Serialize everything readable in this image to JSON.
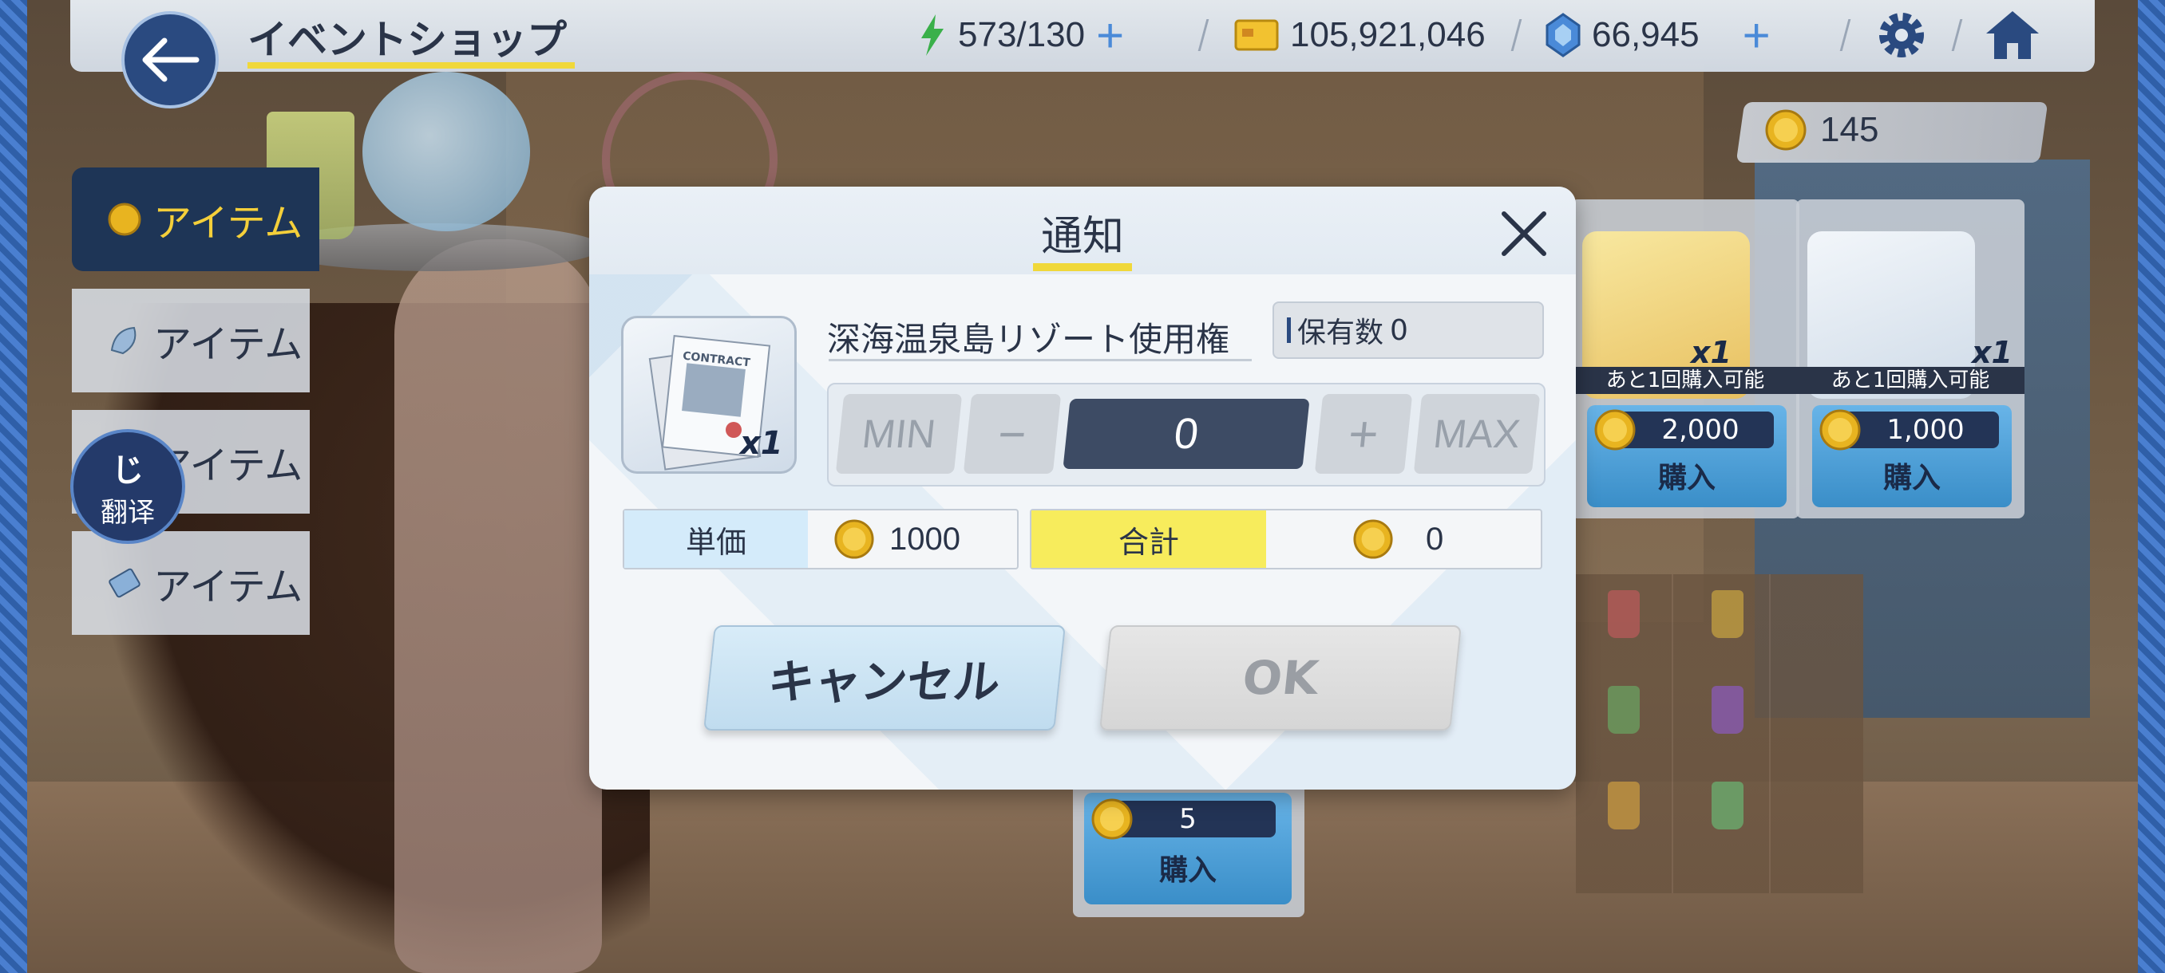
{
  "topbar": {
    "title": "イベントショップ",
    "stamina": "573/130",
    "money": "105,921,046",
    "gems": "66,945"
  },
  "event_coins": "145",
  "tabs": [
    {
      "label": "アイテム",
      "active": true
    },
    {
      "label": "アイテム",
      "active": false
    },
    {
      "label": "アイテム",
      "active": false
    },
    {
      "label": "アイテム",
      "active": false
    }
  ],
  "translate": {
    "label": "翻译",
    "logo": "じ"
  },
  "shop_cards": [
    {
      "limit": "あと1回購入可能",
      "price": "2,000",
      "buy": "購入",
      "qty": "x1"
    },
    {
      "limit": "あと1回購入可能",
      "price": "1,000",
      "buy": "購入",
      "qty": "x1"
    }
  ],
  "bottom_card": {
    "price": "5",
    "buy": "購入"
  },
  "modal": {
    "title": "通知",
    "item_name": "深海温泉島リゾート使用権",
    "item_qty": "x1",
    "item_label": "CONTRACT",
    "owned_label": "保有数",
    "owned_value": "0",
    "min_label": "MIN",
    "minus_label": "−",
    "quantity": "0",
    "plus_label": "+",
    "max_label": "MAX",
    "unit_price_label": "単価",
    "unit_price": "1000",
    "total_label": "合計",
    "total": "0",
    "cancel_label": "キャンセル",
    "ok_label": "OK"
  },
  "colors": {
    "accent_yellow": "#f0d83a",
    "navy": "#2a3448",
    "button_blue": "#3a8ec8"
  }
}
